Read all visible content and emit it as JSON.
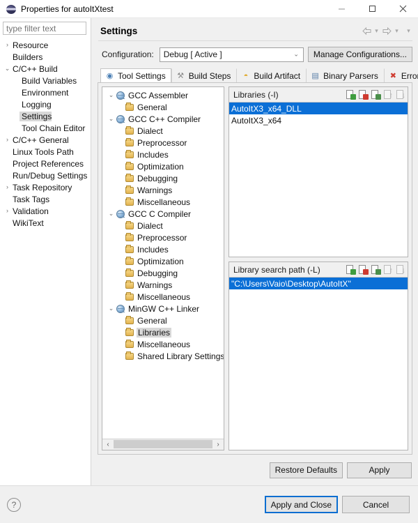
{
  "window": {
    "title": "Properties for autoItXtest",
    "icon": "properties-orb-icon",
    "minimize_label": "—",
    "maximize_label": "□",
    "close_label": "✕"
  },
  "filter": {
    "placeholder": "type filter text",
    "value": ""
  },
  "sidebar": {
    "items": [
      {
        "label": "Resource",
        "arrow": "›",
        "level": 0,
        "selected": false
      },
      {
        "label": "Builders",
        "arrow": "",
        "level": 0,
        "selected": false
      },
      {
        "label": "C/C++ Build",
        "arrow": "⌄",
        "level": 0,
        "selected": false
      },
      {
        "label": "Build Variables",
        "arrow": "",
        "level": 1,
        "selected": false
      },
      {
        "label": "Environment",
        "arrow": "",
        "level": 1,
        "selected": false
      },
      {
        "label": "Logging",
        "arrow": "",
        "level": 1,
        "selected": false
      },
      {
        "label": "Settings",
        "arrow": "",
        "level": 1,
        "selected": true
      },
      {
        "label": "Tool Chain Editor",
        "arrow": "",
        "level": 1,
        "selected": false
      },
      {
        "label": "C/C++ General",
        "arrow": "›",
        "level": 0,
        "selected": false
      },
      {
        "label": "Linux Tools Path",
        "arrow": "",
        "level": 0,
        "selected": false
      },
      {
        "label": "Project References",
        "arrow": "",
        "level": 0,
        "selected": false
      },
      {
        "label": "Run/Debug Settings",
        "arrow": "",
        "level": 0,
        "selected": false
      },
      {
        "label": "Task Repository",
        "arrow": "›",
        "level": 0,
        "selected": false
      },
      {
        "label": "Task Tags",
        "arrow": "",
        "level": 0,
        "selected": false
      },
      {
        "label": "Validation",
        "arrow": "›",
        "level": 0,
        "selected": false
      },
      {
        "label": "WikiText",
        "arrow": "",
        "level": 0,
        "selected": false
      }
    ]
  },
  "page": {
    "title": "Settings",
    "toolbar": {
      "back_icon": "⇦",
      "back_caret": "▾",
      "forward_icon": "⇨",
      "forward_caret": "▾",
      "menu_caret": "▾"
    }
  },
  "configuration": {
    "label": "Configuration:",
    "value": "Debug  [ Active ]",
    "caret": "⌄",
    "manage_button": "Manage Configurations..."
  },
  "tabs": [
    {
      "label": "Tool Settings",
      "icon": "tool-settings-icon",
      "glyph": "◉",
      "color": "#4a7fb5",
      "active": true
    },
    {
      "label": "Build Steps",
      "icon": "wrench-icon",
      "glyph": "⚒",
      "color": "#8a8a8a",
      "active": false
    },
    {
      "label": "Build Artifact",
      "icon": "artifact-icon",
      "glyph": "◓",
      "color": "#e0a92b",
      "active": false
    },
    {
      "label": "Binary Parsers",
      "icon": "binary-parser-icon",
      "glyph": "▤",
      "color": "#5a7fa8",
      "active": false
    },
    {
      "label": "Error Parsers",
      "icon": "error-icon",
      "glyph": "✖",
      "color": "#cf3b30",
      "active": false
    }
  ],
  "tool_tree": [
    {
      "label": "GCC Assembler",
      "arrow": "⌄",
      "icon": "tool",
      "child": false,
      "selected": false
    },
    {
      "label": "General",
      "arrow": "",
      "icon": "folder",
      "child": true,
      "selected": false
    },
    {
      "label": "GCC C++ Compiler",
      "arrow": "⌄",
      "icon": "tool",
      "child": false,
      "selected": false
    },
    {
      "label": "Dialect",
      "arrow": "",
      "icon": "folder",
      "child": true,
      "selected": false
    },
    {
      "label": "Preprocessor",
      "arrow": "",
      "icon": "folder",
      "child": true,
      "selected": false
    },
    {
      "label": "Includes",
      "arrow": "",
      "icon": "folder",
      "child": true,
      "selected": false
    },
    {
      "label": "Optimization",
      "arrow": "",
      "icon": "folder",
      "child": true,
      "selected": false
    },
    {
      "label": "Debugging",
      "arrow": "",
      "icon": "folder",
      "child": true,
      "selected": false
    },
    {
      "label": "Warnings",
      "arrow": "",
      "icon": "folder",
      "child": true,
      "selected": false
    },
    {
      "label": "Miscellaneous",
      "arrow": "",
      "icon": "folder",
      "child": true,
      "selected": false
    },
    {
      "label": "GCC C Compiler",
      "arrow": "⌄",
      "icon": "tool",
      "child": false,
      "selected": false
    },
    {
      "label": "Dialect",
      "arrow": "",
      "icon": "folder",
      "child": true,
      "selected": false
    },
    {
      "label": "Preprocessor",
      "arrow": "",
      "icon": "folder",
      "child": true,
      "selected": false
    },
    {
      "label": "Includes",
      "arrow": "",
      "icon": "folder",
      "child": true,
      "selected": false
    },
    {
      "label": "Optimization",
      "arrow": "",
      "icon": "folder",
      "child": true,
      "selected": false
    },
    {
      "label": "Debugging",
      "arrow": "",
      "icon": "folder",
      "child": true,
      "selected": false
    },
    {
      "label": "Warnings",
      "arrow": "",
      "icon": "folder",
      "child": true,
      "selected": false
    },
    {
      "label": "Miscellaneous",
      "arrow": "",
      "icon": "folder",
      "child": true,
      "selected": false
    },
    {
      "label": "MinGW C++ Linker",
      "arrow": "⌄",
      "icon": "tool",
      "child": false,
      "selected": false
    },
    {
      "label": "General",
      "arrow": "",
      "icon": "folder",
      "child": true,
      "selected": false
    },
    {
      "label": "Libraries",
      "arrow": "",
      "icon": "folder",
      "child": true,
      "selected": true
    },
    {
      "label": "Miscellaneous",
      "arrow": "",
      "icon": "folder",
      "child": true,
      "selected": false
    },
    {
      "label": "Shared Library Settings",
      "arrow": "",
      "icon": "folder",
      "child": true,
      "selected": false
    }
  ],
  "tool_tree_scroll": {
    "left_arrow": "‹",
    "right_arrow": "›"
  },
  "libraries": {
    "title": "Libraries (-I)",
    "tools": [
      {
        "name": "add-icon",
        "kind": "add"
      },
      {
        "name": "delete-icon",
        "kind": "del"
      },
      {
        "name": "edit-icon",
        "kind": "edit"
      },
      {
        "name": "move-up-icon",
        "kind": "up",
        "glyph": "↑"
      },
      {
        "name": "move-down-icon",
        "kind": "down",
        "glyph": "↓"
      }
    ],
    "rows": [
      {
        "value": "AutoItX3_x64_DLL",
        "selected": true
      },
      {
        "value": "AutoItX3_x64",
        "selected": false
      }
    ]
  },
  "library_search_path": {
    "title": "Library search path (-L)",
    "tools": [
      {
        "name": "add-icon",
        "kind": "add"
      },
      {
        "name": "delete-icon",
        "kind": "del"
      },
      {
        "name": "edit-icon",
        "kind": "edit"
      },
      {
        "name": "move-up-icon",
        "kind": "up",
        "glyph": "↑"
      },
      {
        "name": "move-down-icon",
        "kind": "down",
        "glyph": "↓"
      }
    ],
    "rows": [
      {
        "value": "\"C:\\Users\\Vaio\\Desktop\\AutoItX\"",
        "selected": true
      }
    ]
  },
  "page_actions": {
    "restore_defaults": "Restore Defaults",
    "apply": "Apply"
  },
  "footer": {
    "help_glyph": "?",
    "apply_and_close": "Apply and Close",
    "cancel": "Cancel"
  },
  "colors": {
    "selection_blue": "#0b6fd6",
    "tree_selection_grey": "#d8d8d8",
    "default_button_border": "#0a6ed1",
    "dialog_bg": "#f0f0f0"
  }
}
